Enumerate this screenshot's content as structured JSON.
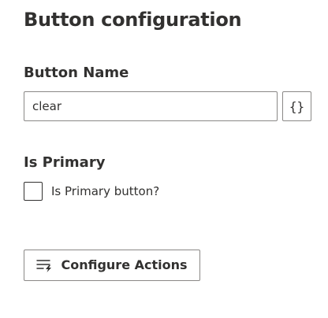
{
  "panel": {
    "title": "Button configuration"
  },
  "button_name": {
    "label": "Button Name",
    "value": "clear",
    "expression_button_label": "{}",
    "expression_icon": "curly-braces-icon"
  },
  "is_primary": {
    "label": "Is Primary",
    "checkbox_label": "Is Primary button?",
    "checked": false
  },
  "configure_actions": {
    "label": "Configure Actions",
    "icon": "actions-list-lightning-icon"
  }
}
